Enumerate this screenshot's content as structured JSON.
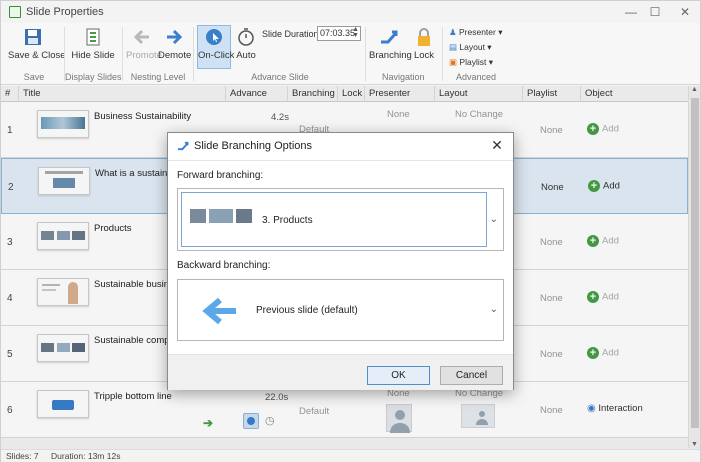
{
  "window": {
    "title": "Slide Properties",
    "controls": [
      "—",
      "☐",
      "✕"
    ]
  },
  "ribbon": {
    "save_close": "Save & Close",
    "hide_slide": "Hide Slide",
    "promote": "Promote",
    "demote": "Demote",
    "on_click": "On-Click",
    "auto": "Auto",
    "slide_duration_label": "Slide Duration:",
    "slide_duration_value": "07:03.35",
    "branching": "Branching",
    "lock": "Lock",
    "presenter": "Presenter",
    "layout": "Layout",
    "playlist": "Playlist",
    "groups": {
      "save": "Save",
      "display": "Display Slides",
      "nesting": "Nesting Level",
      "advance": "Advance Slide",
      "navigation": "Navigation",
      "advanced": "Advanced"
    }
  },
  "columns": [
    "#",
    "Title",
    "Advance",
    "Branching",
    "Lock",
    "Presenter",
    "Layout",
    "Playlist",
    "Object"
  ],
  "rows": [
    {
      "num": "1",
      "title": "Business Sustainability",
      "advance": "4.2s",
      "branching": "Default",
      "presenter": "None",
      "layout": "No Change",
      "playlist": "None",
      "object": "Add"
    },
    {
      "num": "2",
      "title": "What is a sustainabl",
      "advance": "",
      "branching": "",
      "presenter": "",
      "layout": "",
      "playlist": "None",
      "object": "Add"
    },
    {
      "num": "3",
      "title": "Products",
      "advance": "",
      "branching": "",
      "presenter": "",
      "layout": "",
      "playlist": "None",
      "object": "Add"
    },
    {
      "num": "4",
      "title": "Sustainable busines",
      "advance": "",
      "branching": "",
      "presenter": "",
      "layout": "",
      "playlist": "None",
      "object": "Add"
    },
    {
      "num": "5",
      "title": "Sustainable compan",
      "advance": "",
      "branching": "",
      "presenter": "",
      "layout": "",
      "playlist": "None",
      "object": "Add"
    },
    {
      "num": "6",
      "title": "Tripple bottom line",
      "advance": "22.0s",
      "branching": "Default",
      "presenter": "None",
      "layout": "No Change",
      "playlist": "None",
      "object": "Interaction"
    }
  ],
  "status": {
    "slides": "Slides: 7",
    "duration": "Duration: 13m 12s"
  },
  "dialog": {
    "title": "Slide Branching Options",
    "forward_label": "Forward branching:",
    "forward_value": "3. Products",
    "backward_label": "Backward branching:",
    "backward_value": "Previous slide (default)",
    "ok": "OK",
    "cancel": "Cancel"
  },
  "colors": {
    "accent": "#3a7fcc",
    "selected_row": "#e3eef8",
    "add_green": "#45a045"
  }
}
